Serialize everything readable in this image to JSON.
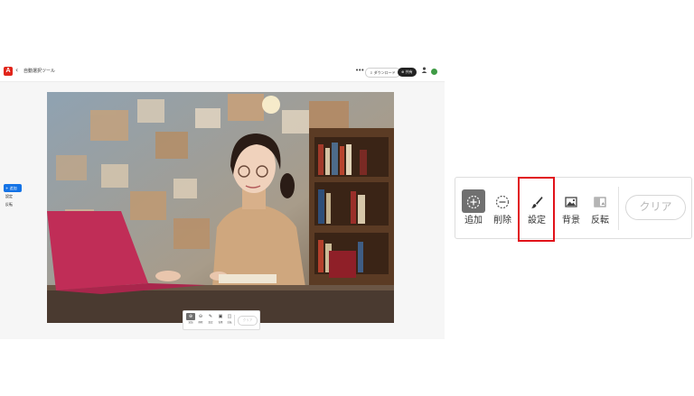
{
  "app": {
    "logo_letter": "A",
    "doc_title": "自動選択ツール",
    "more": "•••",
    "download_label": "⇩ ダウンロード",
    "share_label": "⊕ 共有",
    "left_tools": [
      "+ 追加",
      "設定",
      "反転"
    ],
    "mini_toolbar": {
      "labels": [
        "追加",
        "削除",
        "設定",
        "背景",
        "反転"
      ],
      "clear_label": "クリア"
    }
  },
  "zoom_toolbar": {
    "add_label": "追加",
    "delete_label": "削除",
    "settings_label": "設定",
    "background_label": "背景",
    "invert_label": "反転",
    "clear_label": "クリア"
  },
  "colors": {
    "highlight": "#e1121a",
    "active_tool_bg": "#707070",
    "accent_blue": "#1473e6",
    "brand_red": "#e1251b"
  }
}
